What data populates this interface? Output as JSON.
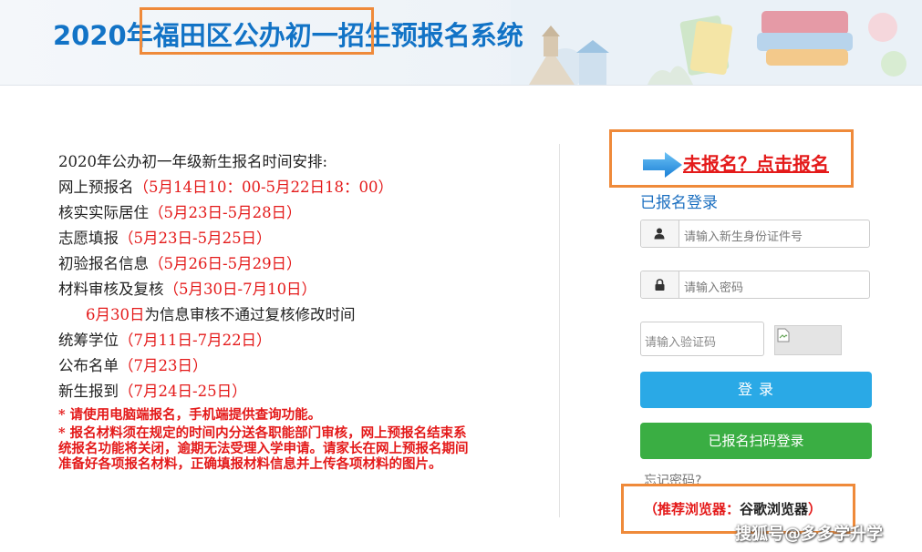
{
  "header": {
    "title": "2020年福田区公办初一招生预报名系统"
  },
  "schedule": {
    "heading": "2020年公办初一年级新生报名时间安排:",
    "items": [
      {
        "label": "网上预报名",
        "time": "（5月14日10：00-5月22日18：00）"
      },
      {
        "label": "核实实际居住",
        "time": "（5月23日-5月28日）"
      },
      {
        "label": "志愿填报",
        "time": "（5月23日-5月25日）"
      },
      {
        "label": "初验报名信息",
        "time": "（5月26日-5月29日）"
      },
      {
        "label": "材料审核及复核",
        "time": "（5月30日-7月10日）"
      }
    ],
    "subnote_red": "6月30日",
    "subnote_rest": "为信息审核不通过复核修改时间",
    "items2": [
      {
        "label": "统筹学位",
        "time": "（7月11日-7月22日）"
      },
      {
        "label": "公布名单",
        "time": "（7月23日）"
      },
      {
        "label": "新生报到",
        "time": "（7月24日-25日）"
      }
    ],
    "notes": [
      "* 请使用电脑端报名，手机端提供查询功能。",
      "* 报名材料须在规定的时间内分送各职能部门审核，网上预报名结束系统报名功能将关闭，逾期无法受理入学申请。请家长在网上预报名期间准备好各项报名材料，正确填报材料信息并上传各项材料的图片。"
    ]
  },
  "login": {
    "register_link": "未报名？点击报名",
    "title": "已报名登录",
    "id_placeholder": "请输入新生身份证件号",
    "password_placeholder": "请输入密码",
    "captcha_placeholder": "请输入验证码",
    "login_button": "登 录",
    "scan_button": "已报名扫码登录",
    "forgot_link": "忘记密码?",
    "browser_prefix": "（推荐浏览器：",
    "browser_name": "谷歌浏览器",
    "browser_suffix": "）"
  },
  "watermark": "搜狐号@多多学升学",
  "colors": {
    "title_blue": "#1273c6",
    "accent_red": "#e41a1a",
    "highlight_orange": "#ef8a3a",
    "login_button": "#2aa9e6",
    "scan_button": "#3aae43"
  },
  "icons": [
    "user-icon",
    "lock-icon",
    "arrow-right-icon",
    "broken-image-icon"
  ]
}
